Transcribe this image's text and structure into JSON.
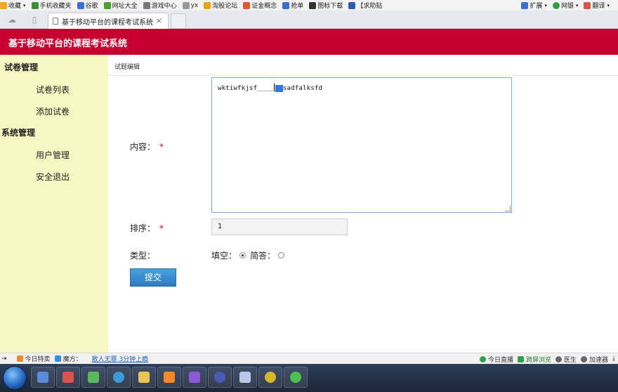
{
  "bookmarks": {
    "items": [
      {
        "label": "收藏",
        "icon": "star-icon",
        "color": "#f5a623"
      },
      {
        "label": "手机收藏夹",
        "icon": "phone-icon",
        "color": "#3a8e3a"
      },
      {
        "label": "谷歌",
        "icon": "google-icon",
        "color": "#3b6fd4"
      },
      {
        "label": "网址大全",
        "icon": "globe-icon",
        "color": "#4aa02c"
      },
      {
        "label": "游戏中心",
        "icon": "gamepad-icon",
        "color": "#777777"
      },
      {
        "label": "yx",
        "icon": "page-icon",
        "color": "#999999"
      },
      {
        "label": "淘股论坛",
        "icon": "sun-icon",
        "color": "#e8a317"
      },
      {
        "label": "证金概念",
        "icon": "fire-icon",
        "color": "#e0572a"
      },
      {
        "label": "抢单",
        "icon": "cursor-icon",
        "color": "#3b6fd4"
      },
      {
        "label": "图标下载",
        "icon": "person-icon",
        "color": "#333333"
      },
      {
        "label": "【求助贴",
        "icon": "paw-icon",
        "color": "#2a5db0"
      }
    ],
    "right": [
      {
        "label": "扩展",
        "icon": "grid-icon",
        "color": "#3b6fd4"
      },
      {
        "label": "网银",
        "icon": "bank-icon",
        "color": "#2e9e4f"
      },
      {
        "label": "翻译",
        "icon": "translate-icon",
        "color": "#d9534f"
      }
    ]
  },
  "tab": {
    "title": "基于移动平台的课程考试系统",
    "close": "×"
  },
  "app": {
    "title": "基于移动平台的课程考试系统"
  },
  "sidebar": {
    "section1": "试卷管理",
    "item1": "试卷列表",
    "item2": "添加试卷",
    "section2": "系统管理",
    "item3": "用户管理",
    "item4": "安全退出"
  },
  "breadcrumb": "试题编辑",
  "form": {
    "content_label": "内容：",
    "content_before": "wktiwfkjsf____",
    "content_selected": "__",
    "content_after": "sadfalksfd",
    "order_label": "排序：",
    "order_value": "1",
    "type_label": "类型：",
    "option_fill": "填空：",
    "option_short": "简答：",
    "required_mark": "*",
    "submit": "提交"
  },
  "statusbar": {
    "hot": "今日特卖",
    "magic": "魔方：",
    "link": "散人无罪 3分钟上瘾",
    "live": "今日直播",
    "cross": "跨屏浏览",
    "doctor": "医生",
    "speed": "加速器"
  },
  "taskbar": {
    "apps": [
      {
        "icon": "window-app-icon",
        "color": "#5b8bd9"
      },
      {
        "icon": "paint-app-icon",
        "color": "#d9534f"
      },
      {
        "icon": "download-app-icon",
        "color": "#5cb85c"
      },
      {
        "icon": "ie-browser-icon",
        "color": "#3b9bd9"
      },
      {
        "icon": "folder-icon",
        "color": "#e8c35a"
      },
      {
        "icon": "sublime-icon",
        "color": "#f0892b"
      },
      {
        "icon": "visual-studio-icon",
        "color": "#8a5ad6"
      },
      {
        "icon": "eclipse-icon",
        "color": "#4a5ab8"
      },
      {
        "icon": "arrow-app-icon",
        "color": "#b9c8e8"
      },
      {
        "icon": "media-app-icon",
        "color": "#d4b82a"
      },
      {
        "icon": "browser-360-icon",
        "color": "#4cbf4c"
      }
    ]
  }
}
